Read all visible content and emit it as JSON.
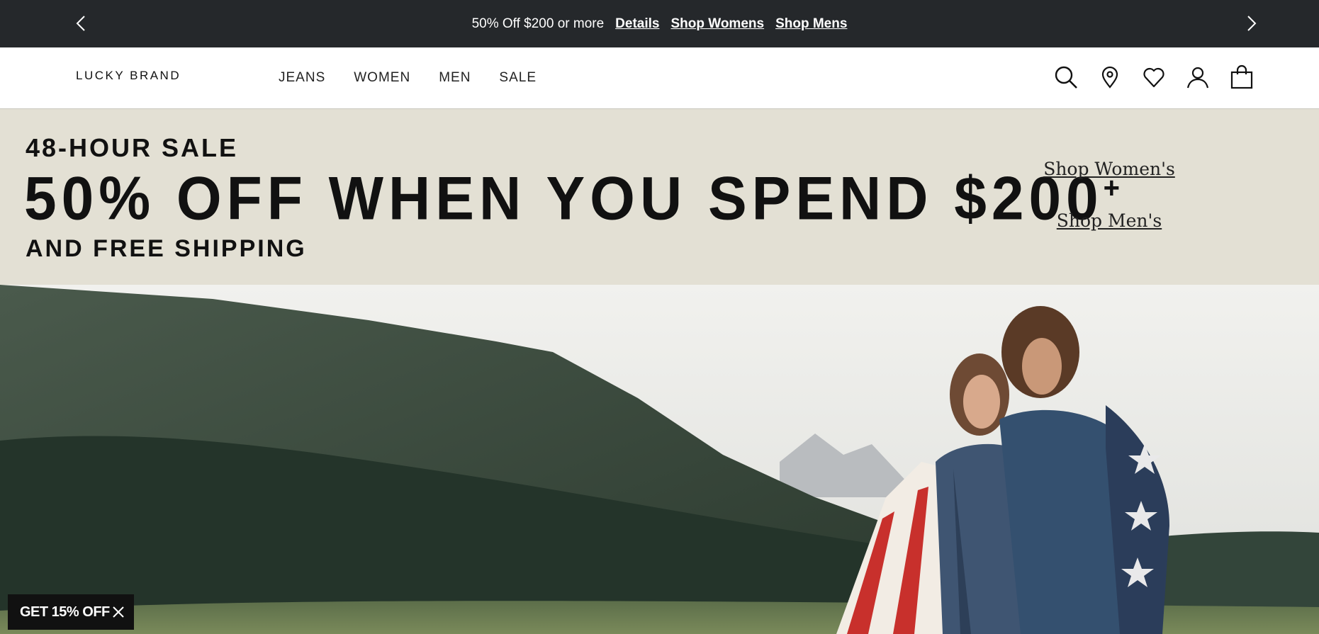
{
  "announcement": {
    "message": "50% Off $200 or more",
    "links": [
      "Details",
      "Shop Womens",
      "Shop Mens"
    ],
    "prev_icon": "chevron-left-icon",
    "next_icon": "chevron-right-icon"
  },
  "header": {
    "logo": "LUCKY BRAND",
    "nav": [
      "JEANS",
      "WOMEN",
      "MEN",
      "SALE"
    ],
    "icons": [
      "search-icon",
      "location-pin-icon",
      "heart-icon",
      "account-icon",
      "shopping-bag-icon"
    ]
  },
  "promo": {
    "kicker": "48-HOUR SALE",
    "headline": "50% OFF WHEN YOU SPEND $200",
    "headline_suffix": "+",
    "subhead": "AND FREE SHIPPING",
    "links": [
      "Shop Women's",
      "Shop Men's"
    ]
  },
  "offer_chip": {
    "label": "GET 15% OFF",
    "close_icon": "close-icon"
  },
  "colors": {
    "announcement_bg": "#25282b",
    "promo_bg": "#e3e0d4",
    "offer_bg": "#111111"
  }
}
